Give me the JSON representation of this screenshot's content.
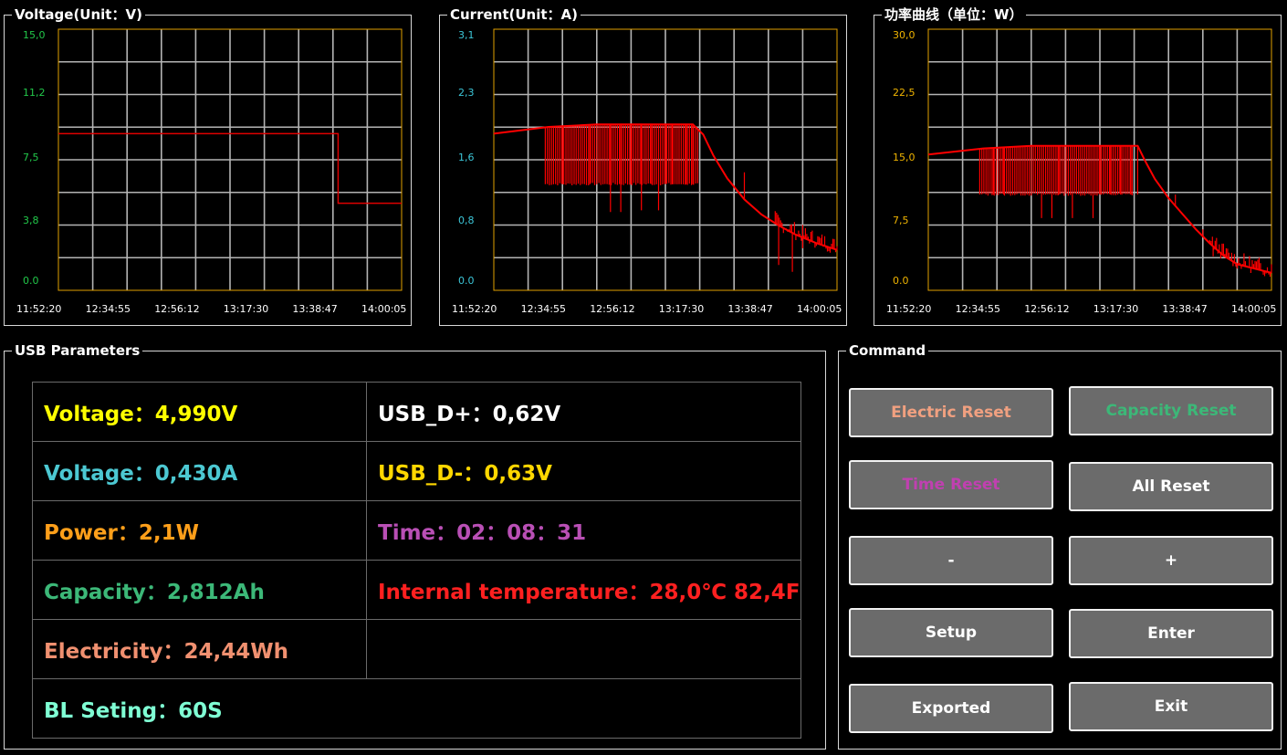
{
  "charts": {
    "voltage": {
      "title": "Voltage(Unit：V)",
      "y_ticks": [
        "15,0",
        "11,2",
        "7,5",
        "3,8",
        "0.0"
      ],
      "x_ticks": [
        "11:52:20",
        "12:34:55",
        "12:56:12",
        "13:17:30",
        "13:38:47",
        "14:00:05"
      ],
      "tick_color": "#22c84a"
    },
    "current": {
      "title": "Current(Unit：A)",
      "y_ticks": [
        "3,1",
        "2,3",
        "1,6",
        "0,8",
        "0.0"
      ],
      "x_ticks": [
        "11:52:20",
        "12:34:55",
        "12:56:12",
        "13:17:30",
        "13:38:47",
        "14:00:05"
      ],
      "tick_color": "#3cc6d8"
    },
    "power": {
      "title": "功率曲线（单位：W）",
      "y_ticks": [
        "30,0",
        "22,5",
        "15,0",
        "7,5",
        "0.0"
      ],
      "x_ticks": [
        "11:52:20",
        "12:34:55",
        "12:56:12",
        "13:17:30",
        "13:38:47",
        "14:00:05"
      ],
      "tick_color": "#f0b400"
    }
  },
  "chart_data": [
    {
      "type": "line",
      "title": "Voltage(Unit：V)",
      "x": [
        "11:52:20",
        "12:34:55",
        "12:56:12",
        "13:17:30",
        "13:38:47",
        "14:00:05"
      ],
      "ylim": [
        0,
        15
      ],
      "grid": true,
      "series": [
        {
          "color": "#e00000",
          "points": [
            [
              "11:52:20",
              9.0
            ],
            [
              "13:38:47",
              9.0
            ],
            [
              "13:38:47",
              5.0
            ],
            [
              "14:00:05",
              5.0
            ]
          ]
        }
      ]
    },
    {
      "type": "line",
      "title": "Current(Unit：A)",
      "x": [
        "11:52:20",
        "12:34:55",
        "12:56:12",
        "13:17:30",
        "13:38:47",
        "14:00:05"
      ],
      "ylim": [
        0,
        3.1
      ],
      "grid": true,
      "series": [
        {
          "color": "#ff0000",
          "base": [
            [
              0,
              1.86
            ],
            [
              0.16,
              1.94
            ],
            [
              0.3,
              1.97
            ],
            [
              0.58,
              1.97
            ],
            [
              0.61,
              1.85
            ],
            [
              0.64,
              1.6
            ],
            [
              0.68,
              1.33
            ],
            [
              0.73,
              1.08
            ],
            [
              0.78,
              0.9
            ],
            [
              0.83,
              0.77
            ],
            [
              0.88,
              0.66
            ],
            [
              0.94,
              0.56
            ],
            [
              1.0,
              0.48
            ]
          ],
          "spikes": [
            [
              0.15,
              1.26
            ],
            [
              0.2,
              1.26
            ],
            [
              0.24,
              1.26
            ],
            [
              0.28,
              1.26
            ],
            [
              0.33,
              1.26
            ],
            [
              0.34,
              0.93
            ],
            [
              0.37,
              0.93
            ],
            [
              0.4,
              1.26
            ],
            [
              0.43,
              0.95
            ],
            [
              0.46,
              1.26
            ],
            [
              0.48,
              0.95
            ],
            [
              0.5,
              1.26
            ],
            [
              0.52,
              1.26
            ],
            [
              0.54,
              1.26
            ],
            [
              0.56,
              1.26
            ],
            [
              0.58,
              1.26
            ],
            [
              0.73,
              1.4
            ],
            [
              0.83,
              0.3
            ],
            [
              0.87,
              0.22
            ],
            [
              0.9,
              0.5
            ]
          ]
        }
      ]
    },
    {
      "type": "line",
      "title": "功率曲线（单位：W）",
      "x": [
        "11:52:20",
        "12:34:55",
        "12:56:12",
        "13:17:30",
        "13:38:47",
        "14:00:05"
      ],
      "ylim": [
        0,
        30
      ],
      "grid": true,
      "series": [
        {
          "color": "#ff0000",
          "base": [
            [
              0,
              15.6
            ],
            [
              0.16,
              16.3
            ],
            [
              0.3,
              16.6
            ],
            [
              0.61,
              16.6
            ],
            [
              0.63,
              15.0
            ],
            [
              0.66,
              12.8
            ],
            [
              0.7,
              10.6
            ],
            [
              0.74,
              8.8
            ],
            [
              0.78,
              7.0
            ],
            [
              0.82,
              5.4
            ],
            [
              0.86,
              4.0
            ],
            [
              0.9,
              3.0
            ],
            [
              0.95,
              2.5
            ],
            [
              1.0,
              2.0
            ]
          ],
          "spikes": [
            [
              0.15,
              11.0
            ],
            [
              0.19,
              11.0
            ],
            [
              0.22,
              11.0
            ],
            [
              0.27,
              11.0
            ],
            [
              0.3,
              11.0
            ],
            [
              0.33,
              8.3
            ],
            [
              0.36,
              8.3
            ],
            [
              0.38,
              11.0
            ],
            [
              0.42,
              8.3
            ],
            [
              0.45,
              11.0
            ],
            [
              0.48,
              8.3
            ],
            [
              0.5,
              11.0
            ],
            [
              0.53,
              11.0
            ],
            [
              0.56,
              11.0
            ],
            [
              0.59,
              11.0
            ],
            [
              0.61,
              11.0
            ],
            [
              0.72,
              11.0
            ],
            [
              0.8,
              7.0
            ],
            [
              0.83,
              3.9
            ]
          ]
        }
      ]
    }
  ],
  "usb": {
    "title": "USB Parameters",
    "voltage": "Voltage：4,990V",
    "current": "Voltage：0,430A",
    "power": "Power：2,1W",
    "capacity": "Capacity：2,812Ah",
    "electricity": "Electricity：24,44Wh",
    "bl": "BL Seting：60S",
    "dplus": "USB_D+：0,62V",
    "dminus": "USB_D-：0,63V",
    "time": "Time：02：08：31",
    "temp": "Internal temperature：28,0℃ 82,4F",
    "colors": {
      "voltage": "#ffff00",
      "current": "#4cc8d2",
      "power": "#ff9f1a",
      "capacity": "#3cb878",
      "electricity": "#f09070",
      "bl": "#7fffd4",
      "dplus": "#ffffff",
      "dminus": "#ffd700",
      "time": "#b94fb5",
      "temp": "#ff2020"
    }
  },
  "command": {
    "title": "Command",
    "electric_reset": "Electric Reset",
    "capacity_reset": "Capacity Reset",
    "time_reset": "Time Reset",
    "all_reset": "All Reset",
    "minus": "-",
    "plus": "+",
    "setup": "Setup",
    "enter": "Enter",
    "exported": "Exported",
    "exit": "Exit",
    "colors": {
      "electric_reset": "#f0a080",
      "capacity_reset": "#3cb878",
      "time_reset": "#c040b0",
      "default": "#ffffff"
    }
  }
}
